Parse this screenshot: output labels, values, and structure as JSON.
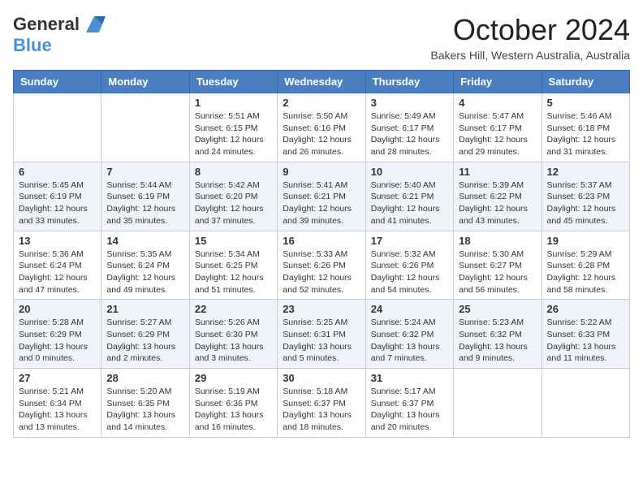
{
  "header": {
    "logo_general": "General",
    "logo_blue": "Blue",
    "month_title": "October 2024",
    "subtitle": "Bakers Hill, Western Australia, Australia"
  },
  "days_of_week": [
    "Sunday",
    "Monday",
    "Tuesday",
    "Wednesday",
    "Thursday",
    "Friday",
    "Saturday"
  ],
  "weeks": [
    [
      {
        "day": "",
        "info": ""
      },
      {
        "day": "",
        "info": ""
      },
      {
        "day": "1",
        "info": "Sunrise: 5:51 AM\nSunset: 6:15 PM\nDaylight: 12 hours and 24 minutes."
      },
      {
        "day": "2",
        "info": "Sunrise: 5:50 AM\nSunset: 6:16 PM\nDaylight: 12 hours and 26 minutes."
      },
      {
        "day": "3",
        "info": "Sunrise: 5:49 AM\nSunset: 6:17 PM\nDaylight: 12 hours and 28 minutes."
      },
      {
        "day": "4",
        "info": "Sunrise: 5:47 AM\nSunset: 6:17 PM\nDaylight: 12 hours and 29 minutes."
      },
      {
        "day": "5",
        "info": "Sunrise: 5:46 AM\nSunset: 6:18 PM\nDaylight: 12 hours and 31 minutes."
      }
    ],
    [
      {
        "day": "6",
        "info": "Sunrise: 5:45 AM\nSunset: 6:19 PM\nDaylight: 12 hours and 33 minutes."
      },
      {
        "day": "7",
        "info": "Sunrise: 5:44 AM\nSunset: 6:19 PM\nDaylight: 12 hours and 35 minutes."
      },
      {
        "day": "8",
        "info": "Sunrise: 5:42 AM\nSunset: 6:20 PM\nDaylight: 12 hours and 37 minutes."
      },
      {
        "day": "9",
        "info": "Sunrise: 5:41 AM\nSunset: 6:21 PM\nDaylight: 12 hours and 39 minutes."
      },
      {
        "day": "10",
        "info": "Sunrise: 5:40 AM\nSunset: 6:21 PM\nDaylight: 12 hours and 41 minutes."
      },
      {
        "day": "11",
        "info": "Sunrise: 5:39 AM\nSunset: 6:22 PM\nDaylight: 12 hours and 43 minutes."
      },
      {
        "day": "12",
        "info": "Sunrise: 5:37 AM\nSunset: 6:23 PM\nDaylight: 12 hours and 45 minutes."
      }
    ],
    [
      {
        "day": "13",
        "info": "Sunrise: 5:36 AM\nSunset: 6:24 PM\nDaylight: 12 hours and 47 minutes."
      },
      {
        "day": "14",
        "info": "Sunrise: 5:35 AM\nSunset: 6:24 PM\nDaylight: 12 hours and 49 minutes."
      },
      {
        "day": "15",
        "info": "Sunrise: 5:34 AM\nSunset: 6:25 PM\nDaylight: 12 hours and 51 minutes."
      },
      {
        "day": "16",
        "info": "Sunrise: 5:33 AM\nSunset: 6:26 PM\nDaylight: 12 hours and 52 minutes."
      },
      {
        "day": "17",
        "info": "Sunrise: 5:32 AM\nSunset: 6:26 PM\nDaylight: 12 hours and 54 minutes."
      },
      {
        "day": "18",
        "info": "Sunrise: 5:30 AM\nSunset: 6:27 PM\nDaylight: 12 hours and 56 minutes."
      },
      {
        "day": "19",
        "info": "Sunrise: 5:29 AM\nSunset: 6:28 PM\nDaylight: 12 hours and 58 minutes."
      }
    ],
    [
      {
        "day": "20",
        "info": "Sunrise: 5:28 AM\nSunset: 6:29 PM\nDaylight: 13 hours and 0 minutes."
      },
      {
        "day": "21",
        "info": "Sunrise: 5:27 AM\nSunset: 6:29 PM\nDaylight: 13 hours and 2 minutes."
      },
      {
        "day": "22",
        "info": "Sunrise: 5:26 AM\nSunset: 6:30 PM\nDaylight: 13 hours and 3 minutes."
      },
      {
        "day": "23",
        "info": "Sunrise: 5:25 AM\nSunset: 6:31 PM\nDaylight: 13 hours and 5 minutes."
      },
      {
        "day": "24",
        "info": "Sunrise: 5:24 AM\nSunset: 6:32 PM\nDaylight: 13 hours and 7 minutes."
      },
      {
        "day": "25",
        "info": "Sunrise: 5:23 AM\nSunset: 6:32 PM\nDaylight: 13 hours and 9 minutes."
      },
      {
        "day": "26",
        "info": "Sunrise: 5:22 AM\nSunset: 6:33 PM\nDaylight: 13 hours and 11 minutes."
      }
    ],
    [
      {
        "day": "27",
        "info": "Sunrise: 5:21 AM\nSunset: 6:34 PM\nDaylight: 13 hours and 13 minutes."
      },
      {
        "day": "28",
        "info": "Sunrise: 5:20 AM\nSunset: 6:35 PM\nDaylight: 13 hours and 14 minutes."
      },
      {
        "day": "29",
        "info": "Sunrise: 5:19 AM\nSunset: 6:36 PM\nDaylight: 13 hours and 16 minutes."
      },
      {
        "day": "30",
        "info": "Sunrise: 5:18 AM\nSunset: 6:37 PM\nDaylight: 13 hours and 18 minutes."
      },
      {
        "day": "31",
        "info": "Sunrise: 5:17 AM\nSunset: 6:37 PM\nDaylight: 13 hours and 20 minutes."
      },
      {
        "day": "",
        "info": ""
      },
      {
        "day": "",
        "info": ""
      }
    ]
  ]
}
